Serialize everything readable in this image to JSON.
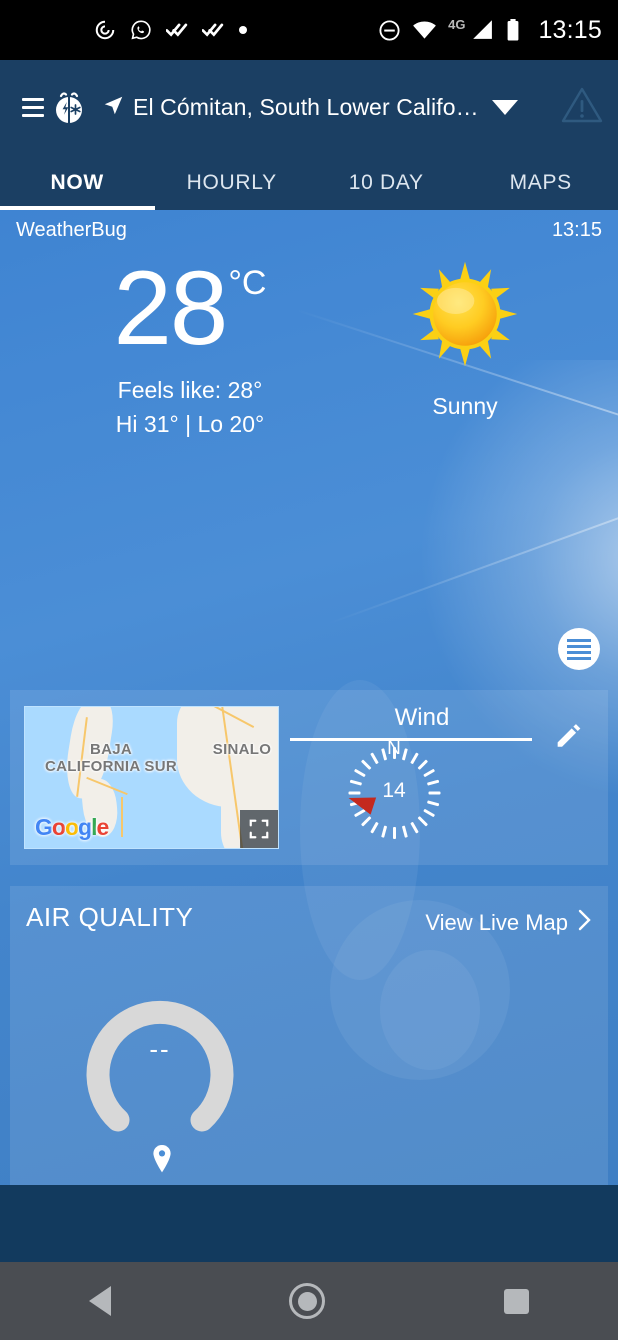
{
  "status_bar": {
    "left_icons": [
      "loading-spinner-icon",
      "whatsapp-icon",
      "double-check-icon",
      "double-check-icon",
      "dot-icon"
    ],
    "right_icons": [
      "do-not-disturb-icon",
      "wifi-icon",
      "cell-signal-icon",
      "battery-icon"
    ],
    "network_label": "4G",
    "clock": "13:15"
  },
  "header": {
    "menu_icon": "hamburger-menu-icon",
    "logo_icon": "weatherbug-logo-icon",
    "location_icon": "location-arrow-icon",
    "location": "El Cómitan, South Lower Californ...",
    "dropdown_icon": "chevron-down-icon",
    "alert_icon": "warning-triangle-icon",
    "bg_color": "#1b3f63"
  },
  "tabs": [
    {
      "label": "NOW",
      "active": true
    },
    {
      "label": "HOURLY",
      "active": false
    },
    {
      "label": "10 DAY",
      "active": false
    },
    {
      "label": "MAPS",
      "active": false
    }
  ],
  "current": {
    "app_name": "WeatherBug",
    "clock": "13:15",
    "temperature": "28",
    "unit": "°C",
    "feels_like": "Feels like: 28°",
    "hi_lo": "Hi 31° | Lo 20°",
    "condition": "Sunny",
    "condition_icon": "sun-icon",
    "layers_icon": "layers-list-icon",
    "sky_color": "#4b8ed6"
  },
  "wind_card": {
    "title": "Wind",
    "edit_icon": "pencil-edit-icon",
    "compass_north_label": "N",
    "speed_value": "14",
    "needle_icon": "wind-direction-needle-icon",
    "map": {
      "labels": [
        "BAJA CALIFORNIA SUR",
        "SINALO"
      ],
      "attribution": "Google",
      "expand_icon": "fullscreen-expand-icon"
    }
  },
  "air_quality": {
    "title": "AIR QUALITY",
    "link_label": "View Live Map",
    "link_icon": "chevron-right-icon",
    "gauge_value": "--",
    "pin_icon": "map-pin-icon",
    "gauge_color": "#d8d8d8"
  },
  "nav_bar": {
    "back_icon": "back-triangle-icon",
    "home_icon": "home-circle-icon",
    "recents_icon": "recents-square-icon",
    "bg_color": "#4a4d52"
  }
}
